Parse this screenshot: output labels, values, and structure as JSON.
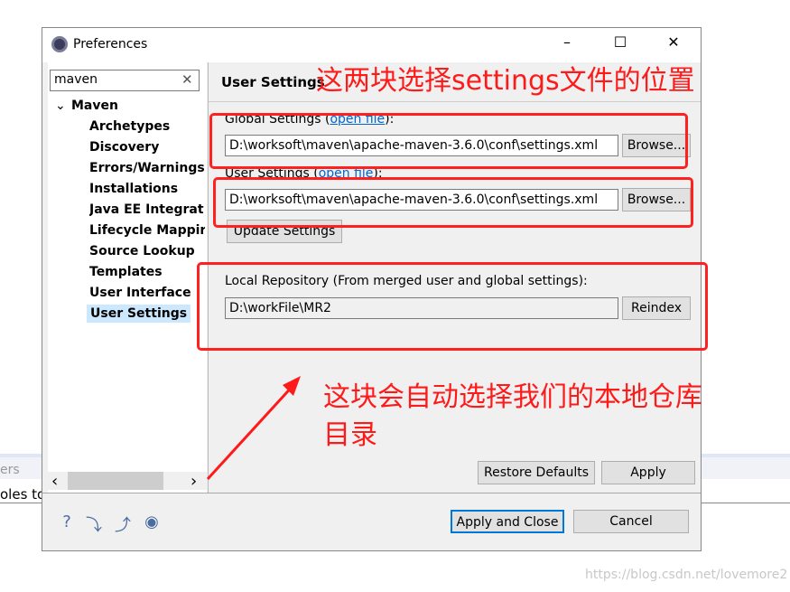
{
  "background": {
    "text1": "ers",
    "text2": "oles to"
  },
  "window": {
    "title": "Preferences",
    "minimize": "–",
    "maximize": "☐",
    "close": "✕"
  },
  "filter": {
    "value": "maven",
    "clear_icon": "clear-icon"
  },
  "tree": {
    "root": "Maven",
    "items": [
      "Archetypes",
      "Discovery",
      "Errors/Warnings",
      "Installations",
      "Java EE Integrat",
      "Lifecycle Mappir",
      "Source Lookup",
      "Templates",
      "User Interface",
      "User Settings"
    ],
    "selected": "User Settings"
  },
  "scroll": {
    "left": "‹",
    "right": "›"
  },
  "page": {
    "title": "User Settings",
    "global_label": "Global Settings (",
    "global_link": "open file",
    "global_end": "):",
    "global_value": "D:\\worksoft\\maven\\apache-maven-3.6.0\\conf\\settings.xml",
    "user_label": "User Settings (",
    "user_link": "open file",
    "user_end": "):",
    "user_value": "D:\\worksoft\\maven\\apache-maven-3.6.0\\conf\\settings.xml",
    "browse": "Browse...",
    "update": "Update Settings",
    "local_label": "Local Repository (From merged user and global settings):",
    "local_value": "D:\\workFile\\MR2",
    "reindex": "Reindex",
    "restore": "Restore Defaults",
    "apply": "Apply"
  },
  "footer": {
    "apply_close": "Apply and Close",
    "cancel": "Cancel",
    "icons": [
      "help-icon",
      "import-icon",
      "export-icon",
      "record-icon"
    ]
  },
  "annotations": {
    "top": "这两块选择settings文件的位置",
    "bottom1": "这块会自动选择我们的本地仓库",
    "bottom2": "目录",
    "color": "#ff1a1a"
  },
  "watermark": "https://blog.csdn.net/lovemore2"
}
